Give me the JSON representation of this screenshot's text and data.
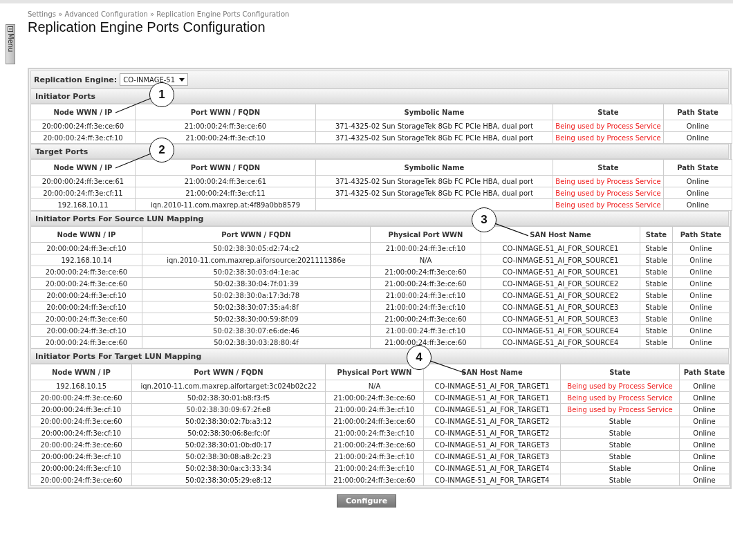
{
  "menu_tab": {
    "label": "Menu"
  },
  "breadcrumb": "Settings » Advanced Configuration » Replication Engine Ports Configuration",
  "title": "Replication Engine Ports Configuration",
  "engine_selector": {
    "label": "Replication Engine:",
    "value": "CO-INMAGE-51"
  },
  "sections": [
    {
      "title": "Initiator Ports",
      "callout": "1",
      "columns": [
        {
          "label": "Node WWN / IP",
          "kind": "text"
        },
        {
          "label": "Port WWN / FQDN",
          "kind": "text"
        },
        {
          "label": "Symbolic Name",
          "kind": "text"
        },
        {
          "label": "State",
          "kind": "state"
        },
        {
          "label": "Path State",
          "kind": "text"
        }
      ],
      "rows": [
        {
          "alert": true,
          "cells": [
            "20:00:00:24:ff:3e:ce:60",
            "21:00:00:24:ff:3e:ce:60",
            "371-4325-02 Sun StorageTek 8Gb FC PCIe HBA, dual port",
            "Being used by Process Service",
            "Online"
          ]
        },
        {
          "alert": true,
          "cells": [
            "20:00:00:24:ff:3e:cf:10",
            "21:00:00:24:ff:3e:cf:10",
            "371-4325-02 Sun StorageTek 8Gb FC PCIe HBA, dual port",
            "Being used by Process Service",
            "Online"
          ]
        }
      ]
    },
    {
      "title": "Target Ports",
      "callout": "2",
      "columns": [
        {
          "label": "Node WWN / IP",
          "kind": "text"
        },
        {
          "label": "Port WWN / FQDN",
          "kind": "text"
        },
        {
          "label": "Symbolic Name",
          "kind": "text"
        },
        {
          "label": "State",
          "kind": "state"
        },
        {
          "label": "Path State",
          "kind": "text"
        }
      ],
      "rows": [
        {
          "alert": true,
          "cells": [
            "20:00:00:24:ff:3e:ce:61",
            "21:00:00:24:ff:3e:ce:61",
            "371-4325-02 Sun StorageTek 8Gb FC PCIe HBA, dual port",
            "Being used by Process Service",
            "Online"
          ]
        },
        {
          "alert": true,
          "cells": [
            "20:00:00:24:ff:3e:cf:11",
            "21:00:00:24:ff:3e:cf:11",
            "371-4325-02 Sun StorageTek 8Gb FC PCIe HBA, dual port",
            "Being used by Process Service",
            "Online"
          ]
        },
        {
          "alert": true,
          "cells": [
            "192.168.10.11",
            "iqn.2010-11.com.maxrep.at:4f89a0bb8579",
            null,
            "Being used by Process Service",
            "Online"
          ]
        }
      ]
    },
    {
      "title": "Initiator Ports For Source LUN Mapping",
      "callout": "3",
      "columns": [
        {
          "label": "Node WWN / IP",
          "kind": "text"
        },
        {
          "label": "Port WWN / FQDN",
          "kind": "text"
        },
        {
          "label": "Physical Port WWN",
          "kind": "text"
        },
        {
          "label": "SAN Host Name",
          "kind": "text"
        },
        {
          "label": "State",
          "kind": "state"
        },
        {
          "label": "Path State",
          "kind": "text"
        }
      ],
      "rows": [
        {
          "alert": false,
          "cells": [
            "20:00:00:24:ff:3e:cf:10",
            "50:02:38:30:05:d2:74:c2",
            "21:00:00:24:ff:3e:cf:10",
            "CO-INMAGE-51_AI_FOR_SOURCE1",
            "Stable",
            "Online"
          ]
        },
        {
          "alert": false,
          "cells": [
            "192.168.10.14",
            "iqn.2010-11.com.maxrep.aiforsource:2021111386e",
            "N/A",
            "CO-INMAGE-51_AI_FOR_SOURCE1",
            "Stable",
            "Online"
          ]
        },
        {
          "alert": false,
          "cells": [
            "20:00:00:24:ff:3e:ce:60",
            "50:02:38:30:03:d4:1e:ac",
            "21:00:00:24:ff:3e:ce:60",
            "CO-INMAGE-51_AI_FOR_SOURCE1",
            "Stable",
            "Online"
          ]
        },
        {
          "alert": false,
          "cells": [
            "20:00:00:24:ff:3e:ce:60",
            "50:02:38:30:04:7f:01:39",
            "21:00:00:24:ff:3e:ce:60",
            "CO-INMAGE-51_AI_FOR_SOURCE2",
            "Stable",
            "Online"
          ]
        },
        {
          "alert": false,
          "cells": [
            "20:00:00:24:ff:3e:cf:10",
            "50:02:38:30:0a:17:3d:78",
            "21:00:00:24:ff:3e:cf:10",
            "CO-INMAGE-51_AI_FOR_SOURCE2",
            "Stable",
            "Online"
          ]
        },
        {
          "alert": false,
          "cells": [
            "20:00:00:24:ff:3e:cf:10",
            "50:02:38:30:07:35:a4:8f",
            "21:00:00:24:ff:3e:cf:10",
            "CO-INMAGE-51_AI_FOR_SOURCE3",
            "Stable",
            "Online"
          ]
        },
        {
          "alert": false,
          "cells": [
            "20:00:00:24:ff:3e:ce:60",
            "50:02:38:30:00:59:8f:09",
            "21:00:00:24:ff:3e:ce:60",
            "CO-INMAGE-51_AI_FOR_SOURCE3",
            "Stable",
            "Online"
          ]
        },
        {
          "alert": false,
          "cells": [
            "20:00:00:24:ff:3e:cf:10",
            "50:02:38:30:07:e6:de:46",
            "21:00:00:24:ff:3e:cf:10",
            "CO-INMAGE-51_AI_FOR_SOURCE4",
            "Stable",
            "Online"
          ]
        },
        {
          "alert": false,
          "cells": [
            "20:00:00:24:ff:3e:ce:60",
            "50:02:38:30:03:28:80:4f",
            "21:00:00:24:ff:3e:ce:60",
            "CO-INMAGE-51_AI_FOR_SOURCE4",
            "Stable",
            "Online"
          ]
        }
      ]
    },
    {
      "title": "Initiator Ports For Target LUN Mapping",
      "callout": "4",
      "columns": [
        {
          "label": "Node WWN / IP",
          "kind": "text"
        },
        {
          "label": "Port WWN / FQDN",
          "kind": "text"
        },
        {
          "label": "Physical Port WWN",
          "kind": "text"
        },
        {
          "label": "SAN Host Name",
          "kind": "text"
        },
        {
          "label": "State",
          "kind": "state"
        },
        {
          "label": "Path State",
          "kind": "text"
        }
      ],
      "rows": [
        {
          "alert": true,
          "cells": [
            "192.168.10.15",
            "iqn.2010-11.com.maxrep.aifortarget:3c024b02c22",
            "N/A",
            "CO-INMAGE-51_AI_FOR_TARGET1",
            "Being used by Process Service",
            "Online"
          ]
        },
        {
          "alert": true,
          "cells": [
            "20:00:00:24:ff:3e:ce:60",
            "50:02:38:30:01:b8:f3:f5",
            "21:00:00:24:ff:3e:ce:60",
            "CO-INMAGE-51_AI_FOR_TARGET1",
            "Being used by Process Service",
            "Online"
          ]
        },
        {
          "alert": true,
          "cells": [
            "20:00:00:24:ff:3e:cf:10",
            "50:02:38:30:09:67:2f:e8",
            "21:00:00:24:ff:3e:cf:10",
            "CO-INMAGE-51_AI_FOR_TARGET1",
            "Being used by Process Service",
            "Online"
          ]
        },
        {
          "alert": false,
          "cells": [
            "20:00:00:24:ff:3e:ce:60",
            "50:02:38:30:02:7b:a3:12",
            "21:00:00:24:ff:3e:ce:60",
            "CO-INMAGE-51_AI_FOR_TARGET2",
            "Stable",
            "Online"
          ]
        },
        {
          "alert": false,
          "cells": [
            "20:00:00:24:ff:3e:cf:10",
            "50:02:38:30:06:8e:fc:0f",
            "21:00:00:24:ff:3e:cf:10",
            "CO-INMAGE-51_AI_FOR_TARGET2",
            "Stable",
            "Online"
          ]
        },
        {
          "alert": false,
          "cells": [
            "20:00:00:24:ff:3e:ce:60",
            "50:02:38:30:01:0b:d0:17",
            "21:00:00:24:ff:3e:ce:60",
            "CO-INMAGE-51_AI_FOR_TARGET3",
            "Stable",
            "Online"
          ]
        },
        {
          "alert": false,
          "cells": [
            "20:00:00:24:ff:3e:cf:10",
            "50:02:38:30:08:a8:2c:23",
            "21:00:00:24:ff:3e:cf:10",
            "CO-INMAGE-51_AI_FOR_TARGET3",
            "Stable",
            "Online"
          ]
        },
        {
          "alert": false,
          "cells": [
            "20:00:00:24:ff:3e:cf:10",
            "50:02:38:30:0a:c3:33:34",
            "21:00:00:24:ff:3e:cf:10",
            "CO-INMAGE-51_AI_FOR_TARGET4",
            "Stable",
            "Online"
          ]
        },
        {
          "alert": false,
          "cells": [
            "20:00:00:24:ff:3e:ce:60",
            "50:02:38:30:05:29:e8:12",
            "21:00:00:24:ff:3e:ce:60",
            "CO-INMAGE-51_AI_FOR_TARGET4",
            "Stable",
            "Online"
          ]
        }
      ]
    }
  ],
  "configure_button": "Configure"
}
